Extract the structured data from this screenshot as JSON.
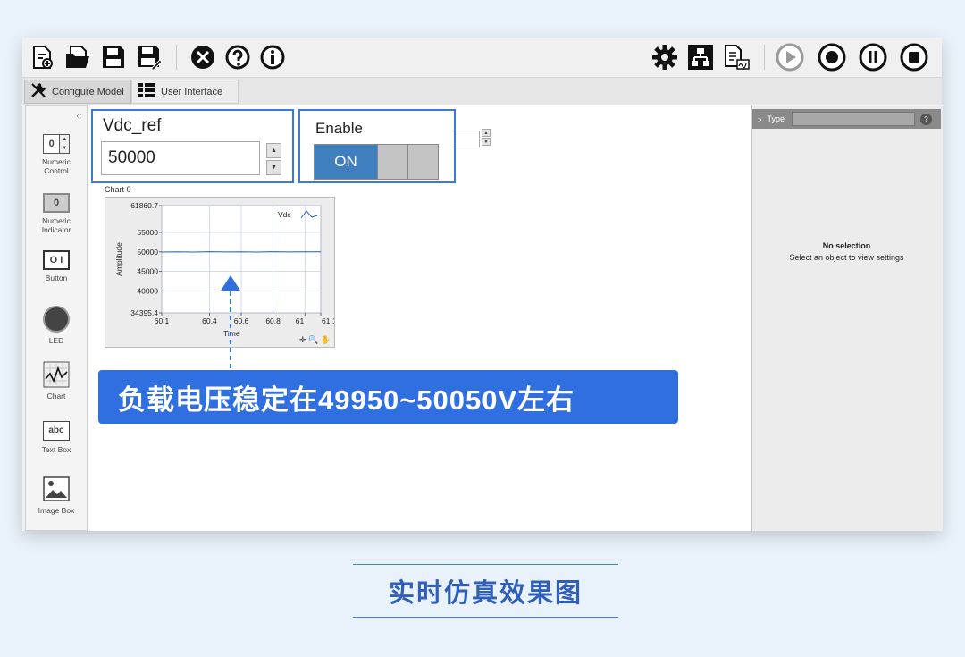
{
  "toolbar": {
    "left_icons": [
      "new-model-icon",
      "open-folder-icon",
      "save-icon",
      "save-as-icon",
      "tools-icon",
      "help-icon",
      "info-icon"
    ],
    "right_icons": [
      "settings-icon",
      "hierarchy-icon",
      "export-report-icon",
      "run-icon",
      "record-icon",
      "pause-icon",
      "stop-icon"
    ]
  },
  "tabs": [
    {
      "label": "Configure Model",
      "icon": "wrench-icon"
    },
    {
      "label": "User Interface",
      "icon": "ui-list-icon"
    }
  ],
  "palette": {
    "collapse_glyph": "‹‹",
    "items": [
      {
        "label_line1": "Numeric",
        "label_line2": "Control",
        "glyph": "0"
      },
      {
        "label_line1": "Numeric",
        "label_line2": "Indicator",
        "glyph": "0"
      },
      {
        "label_line1": "Button",
        "label_line2": "",
        "glyph": "O I"
      },
      {
        "label_line1": "LED",
        "label_line2": "",
        "glyph": ""
      },
      {
        "label_line1": "Chart",
        "label_line2": "",
        "glyph": ""
      },
      {
        "label_line1": "Text Box",
        "label_line2": "",
        "glyph": "abc"
      },
      {
        "label_line1": "Image Box",
        "label_line2": "",
        "glyph": ""
      }
    ]
  },
  "vdc_control": {
    "label": "Vdc_ref",
    "value": "50000"
  },
  "enable_control": {
    "label": "Enable",
    "state": "ON"
  },
  "chart": {
    "title": "Chart 0",
    "legend": "Vdc",
    "xlabel": "Time",
    "ylabel": "Amplitude",
    "ytick_labels": [
      "61860.7",
      "55000",
      "50000",
      "45000",
      "40000",
      "34395.4"
    ],
    "xtick_labels": [
      "60.1",
      "60.4",
      "60.6",
      "60.8",
      "61",
      "61.1"
    ],
    "tool_icons": "✛ 🔍 ✋"
  },
  "chart_data": {
    "type": "line",
    "title": "Chart 0",
    "xlabel": "Time",
    "ylabel": "Amplitude",
    "ylim": [
      34395.4,
      61860.7
    ],
    "xlim": [
      60.1,
      61.1
    ],
    "grid": true,
    "legend_placement": "top-right",
    "series": [
      {
        "name": "Vdc",
        "x": [
          60.1,
          60.2,
          60.3,
          60.4,
          60.5,
          60.6,
          60.7,
          60.8,
          60.9,
          61.0,
          61.1
        ],
        "values": [
          49970,
          50030,
          49960,
          50040,
          49980,
          50020,
          49950,
          50050,
          49990,
          50010,
          50000
        ]
      }
    ],
    "colors": {
      "Vdc": "#1f5fbf"
    }
  },
  "properties": {
    "header": "Type",
    "help": "?",
    "no_selection": "No selection",
    "hint": "Select an object to view settings"
  },
  "overlay": {
    "text": "负载电压稳定在49950~50050V左右"
  },
  "caption": {
    "text": "实时仿真效果图"
  }
}
